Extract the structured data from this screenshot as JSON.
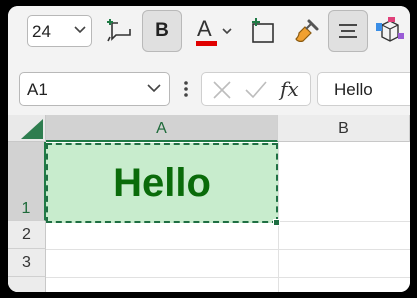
{
  "ribbon": {
    "font_size": "24",
    "bold_label": "B",
    "font_color_letter": "A",
    "font_color_hex": "#e00000"
  },
  "formula_bar": {
    "name_box": "A1",
    "fx_label": "fx",
    "content": "Hello"
  },
  "grid": {
    "columns": [
      "A",
      "B"
    ],
    "rows": [
      "1",
      "2",
      "3"
    ],
    "selected_cell": "A1",
    "cell_a1_value": "Hello",
    "cell_a1_fill": "#c8eccd",
    "cell_a1_text_color": "#0a6b0a"
  }
}
